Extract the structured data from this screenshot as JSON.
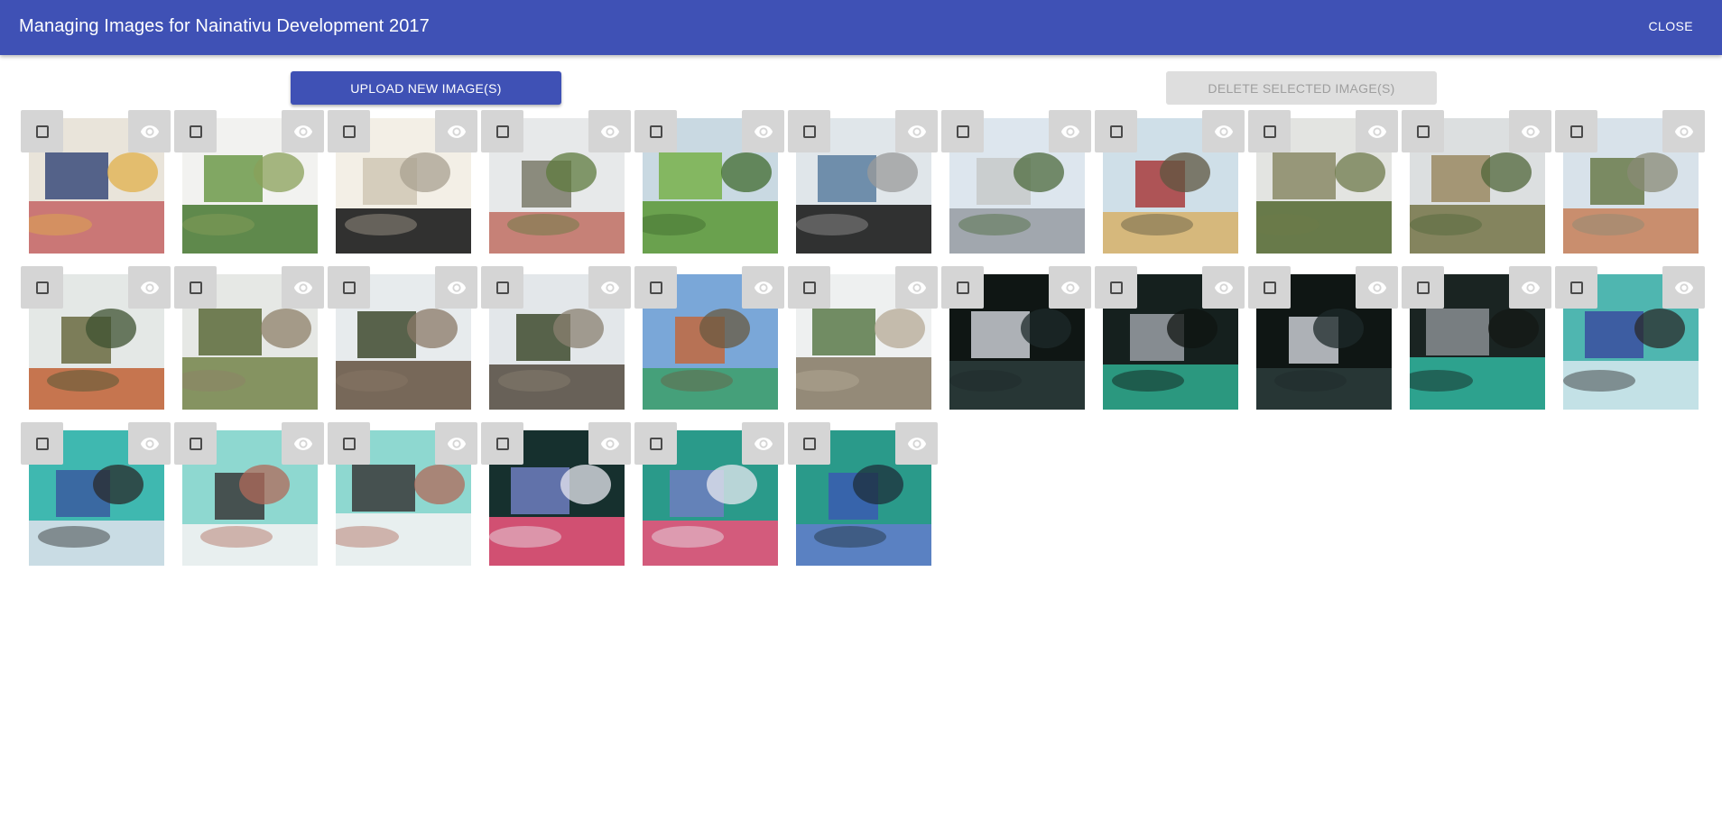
{
  "theme": {
    "primary": "#3f51b5",
    "disabled_bg": "#dedede",
    "disabled_text": "#9e9e9e",
    "overlay": "#d5d5d5"
  },
  "header": {
    "title": "Managing Images for Nainativu Development 2017",
    "close_label": "CLOSE"
  },
  "actions": {
    "upload_label": "UPLOAD NEW IMAGE(S)",
    "delete_label": "DELETE SELECTED IMAGE(S)",
    "delete_disabled": true
  },
  "icons": {
    "select": "checkbox-outline-icon",
    "view": "eye-icon"
  },
  "images": [
    {
      "subject": "group of people outside building",
      "palette": [
        "#e9e4da",
        "#c76a6a",
        "#3a4b7a",
        "#e0b04a"
      ]
    },
    {
      "subject": "green trees and signboard",
      "palette": [
        "#f2f2f0",
        "#4f7d3a",
        "#6d9a4a",
        "#8aa05a"
      ]
    },
    {
      "subject": "stone plaque close-up",
      "palette": [
        "#f3efe6",
        "#1c1c1c",
        "#cfc7b4",
        "#a8a090"
      ]
    },
    {
      "subject": "entrance gate",
      "palette": [
        "#e7e9ea",
        "#c2766a",
        "#7a7a6a",
        "#5e7a3e"
      ]
    },
    {
      "subject": "overgrown bushes",
      "palette": [
        "#c9d9e2",
        "#5f9a3e",
        "#78b04a",
        "#3f6a2e"
      ]
    },
    {
      "subject": "foundation plaque text",
      "palette": [
        "#e0e6ea",
        "#1d1d1d",
        "#5a7ea0",
        "#9a9a9a"
      ]
    },
    {
      "subject": "road beside wall",
      "palette": [
        "#dde6ee",
        "#9aa0a6",
        "#c7c9c9",
        "#4c6a3c"
      ]
    },
    {
      "subject": "yellow building",
      "palette": [
        "#cfdfe8",
        "#d6b470",
        "#a83c3c",
        "#5e5640"
      ]
    },
    {
      "subject": "field with signboard",
      "palette": [
        "#e3e4e1",
        "#5a6e3a",
        "#8a8a66",
        "#6d7a4a"
      ]
    },
    {
      "subject": "dry field",
      "palette": [
        "#dcdfe0",
        "#7a7a50",
        "#9a8a62",
        "#50663a"
      ]
    },
    {
      "subject": "orange building and shrubs",
      "palette": [
        "#d8e2ea",
        "#c88560",
        "#6a7a4a",
        "#8a8a76"
      ]
    },
    {
      "subject": "long building under trees",
      "palette": [
        "#e4e8e6",
        "#c2683e",
        "#6a6a40",
        "#3e5230"
      ]
    },
    {
      "subject": "open land with plants",
      "palette": [
        "#e6e8e5",
        "#7a8a52",
        "#5a6a3a",
        "#8e8068"
      ]
    },
    {
      "subject": "cleared ground",
      "palette": [
        "#e7ebed",
        "#6a5a48",
        "#3e4a2e",
        "#8a7866"
      ]
    },
    {
      "subject": "fallen branches",
      "palette": [
        "#e3e7ea",
        "#5a5248",
        "#3e4a2e",
        "#8a8070"
      ]
    },
    {
      "subject": "green building",
      "palette": [
        "#7aa7d8",
        "#3fa070",
        "#c2683e",
        "#6a5a40"
      ]
    },
    {
      "subject": "fence and signboard",
      "palette": [
        "#eef0f0",
        "#8a7e6a",
        "#5a7a4a",
        "#b6aa96"
      ]
    },
    {
      "subject": "wheelchair in dark room",
      "palette": [
        "#0f1614",
        "#2a3a38",
        "#c9ccd2",
        "#1e2a2a"
      ]
    },
    {
      "subject": "wheelchair by wall",
      "palette": [
        "#15201e",
        "#2ea58a",
        "#9aa0a6",
        "#0f1412"
      ]
    },
    {
      "subject": "wheelchair in dark room",
      "palette": [
        "#0f1614",
        "#2a3a38",
        "#c9ccd2",
        "#1e2a2a"
      ]
    },
    {
      "subject": "two wheelchairs",
      "palette": [
        "#1a2422",
        "#30b09a",
        "#8a8e92",
        "#141816"
      ]
    },
    {
      "subject": "ward with beds",
      "palette": [
        "#4fb6b0",
        "#cfe6ec",
        "#3a4ea0",
        "#2a2a2a"
      ]
    },
    {
      "subject": "ward with beds and nets",
      "palette": [
        "#3fb8b0",
        "#d8e0ea",
        "#3a5aa0",
        "#2a2a2a"
      ]
    },
    {
      "subject": "group photo with beds",
      "palette": [
        "#8ed8d0",
        "#f2f2f2",
        "#3a3a3a",
        "#b06a5a"
      ]
    },
    {
      "subject": "group photo with beds",
      "palette": [
        "#8ed8d0",
        "#f2f2f2",
        "#3a3a3a",
        "#b06a5a"
      ]
    },
    {
      "subject": "beds with striped sheets",
      "palette": [
        "#16302e",
        "#e6547a",
        "#6e7ec0",
        "#e8e8f0"
      ]
    },
    {
      "subject": "bed with striped sheet",
      "palette": [
        "#2a9a8a",
        "#e6547a",
        "#6e7ec0",
        "#e8e8f0"
      ]
    },
    {
      "subject": "mosquito net",
      "palette": [
        "#2a9a8a",
        "#5f7ec8",
        "#3a5ab0",
        "#1e2e3a"
      ]
    }
  ]
}
